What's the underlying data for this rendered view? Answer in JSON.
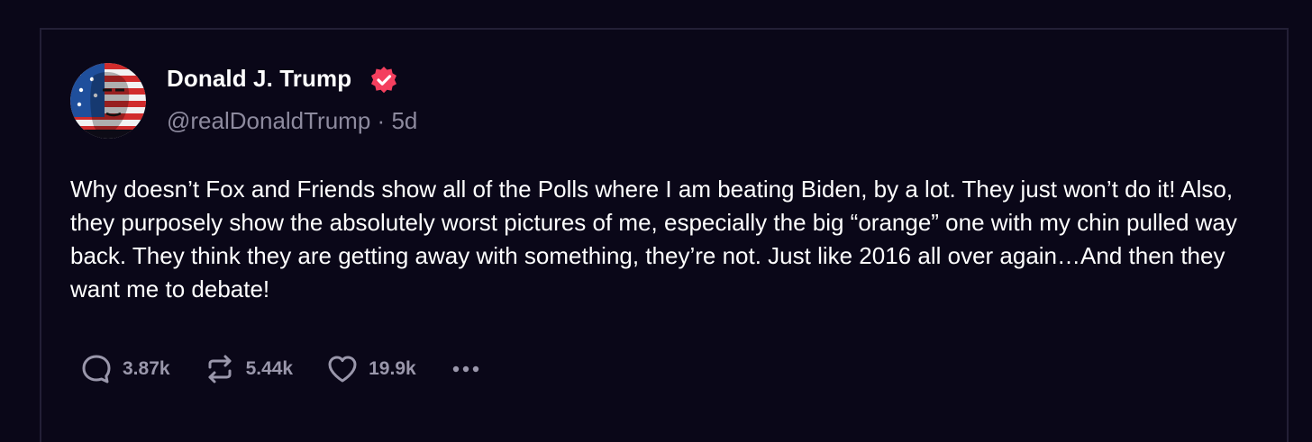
{
  "post": {
    "author_name": "Donald J. Trump",
    "handle": "@realDonaldTrump",
    "separator": "·",
    "time": "5d",
    "body": "Why doesn’t Fox and Friends show all of the Polls where I am beating Biden, by a lot. They just won’t do it! Also, they purposely show the absolutely worst pictures of me, especially the big “orange” one with my chin pulled way back. They think they are getting away with something, they’re not. Just like 2016 all over again…And then they want me to debate!"
  },
  "actions": {
    "replies": "3.87k",
    "restores": "5.44k",
    "likes": "19.9k"
  },
  "icons": {
    "verified": "verified-badge-icon",
    "reply": "comment-bubble-icon",
    "restore": "repost-arrows-icon",
    "like": "heart-icon",
    "more": "more-dots-icon"
  },
  "colors": {
    "background": "#0a0718",
    "border": "#231f36",
    "text": "#ffffff",
    "muted": "#8d8a9e",
    "verified": "#f43f5e"
  }
}
